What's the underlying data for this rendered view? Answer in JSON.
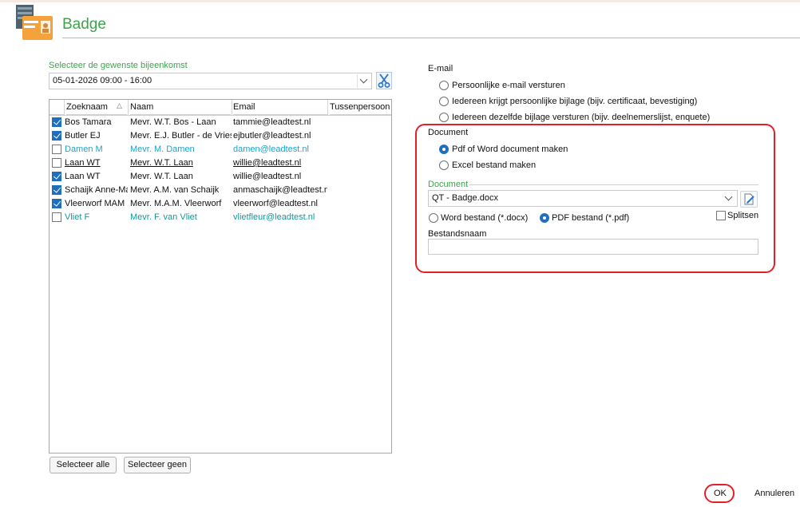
{
  "window": {
    "title": "Badge"
  },
  "event_select": {
    "label": "Selecteer de gewenste bijeenkomst",
    "value": "05-01-2026   09:00 - 16:00"
  },
  "grid": {
    "columns": [
      "Zoeknaam",
      "Naam",
      "Email",
      "Tussenpersoon"
    ],
    "rows": [
      {
        "checked": true,
        "zoeknaam": "Bos Tamara",
        "naam": "Mevr. W.T. Bos - Laan",
        "email": "tammie@leadtest.nl",
        "style": "normal"
      },
      {
        "checked": true,
        "zoeknaam": "Butler EJ",
        "naam": "Mevr. E.J. Butler - de Vries",
        "email": "ejbutler@leadtest.nl",
        "style": "normal"
      },
      {
        "checked": false,
        "zoeknaam": "Damen M",
        "naam": "Mevr. M. Damen",
        "email": "damen@leadtest.nl",
        "style": "cyan"
      },
      {
        "checked": false,
        "zoeknaam": "Laan WT",
        "naam": "Mevr. W.T. Laan",
        "email": "willie@leadtest.nl",
        "style": "underline"
      },
      {
        "checked": true,
        "zoeknaam": "Laan WT",
        "naam": "Mevr. W.T. Laan",
        "email": "willie@leadtest.nl",
        "style": "normal"
      },
      {
        "checked": true,
        "zoeknaam": "Schaijk Anne-Marie",
        "naam": "Mevr. A.M. van Schaijk",
        "email": "anmaschaijk@leadtest.nl",
        "style": "normal"
      },
      {
        "checked": true,
        "zoeknaam": "Vleerworf MAM",
        "naam": "Mevr. M.A.M. Vleerworf",
        "email": "vleerworf@leadtest.nl",
        "style": "normal"
      },
      {
        "checked": false,
        "zoeknaam": "Vliet F",
        "naam": "Mevr. F. van Vliet",
        "email": "vlietfleur@leadtest.nl",
        "style": "teal"
      }
    ]
  },
  "buttons": {
    "select_all": "Selecteer alle",
    "select_none": "Selecteer geen",
    "ok": "OK",
    "cancel": "Annuleren"
  },
  "email_section": {
    "label": "E-mail",
    "options": [
      {
        "label": "Persoonlijke e-mail versturen",
        "selected": false
      },
      {
        "label": "Iedereen krijgt persoonlijke bijlage (bijv. certificaat, bevestiging)",
        "selected": false
      },
      {
        "label": "Iedereen dezelfde bijlage versturen (bijv. deelnemerslijst, enquete)",
        "selected": false
      }
    ]
  },
  "document_section": {
    "label": "Document",
    "options": [
      {
        "label": "Pdf of Word document maken",
        "selected": true
      },
      {
        "label": "Excel bestand maken",
        "selected": false
      }
    ],
    "doc_label": "Document",
    "doc_value": "QT - Badge.docx",
    "format_options": [
      {
        "label": "Word bestand (*.docx)",
        "selected": false
      },
      {
        "label": "PDF bestand (*.pdf)",
        "selected": true
      }
    ],
    "split_label": "Splitsen",
    "split_checked": false,
    "filename_label": "Bestandsnaam",
    "filename_value": ""
  },
  "colors": {
    "accent_green": "#3fa34d",
    "highlight_red": "#e0202a",
    "check_blue": "#1f6fc0"
  },
  "icons": {
    "app": "badge-app-icon",
    "scissors": "scissors-icon",
    "edit": "edit-document-icon"
  }
}
